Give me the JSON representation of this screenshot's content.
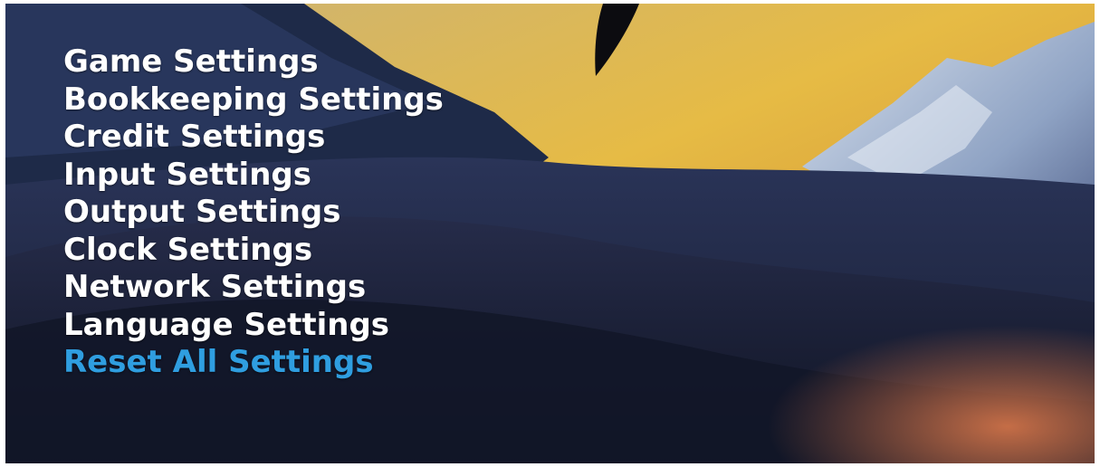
{
  "menu": {
    "items": [
      {
        "label": "Game Settings"
      },
      {
        "label": "Bookkeeping Settings"
      },
      {
        "label": "Credit Settings"
      },
      {
        "label": "Input Settings"
      },
      {
        "label": "Output Settings"
      },
      {
        "label": "Clock Settings"
      },
      {
        "label": "Network Settings"
      },
      {
        "label": "Language Settings"
      },
      {
        "label": "Reset All Settings"
      }
    ],
    "selected_index": 8
  },
  "colors": {
    "text": "#ffffff",
    "selected": "#2f9ee0",
    "sky": "#e8b94a",
    "mountain": "#1c2440"
  }
}
